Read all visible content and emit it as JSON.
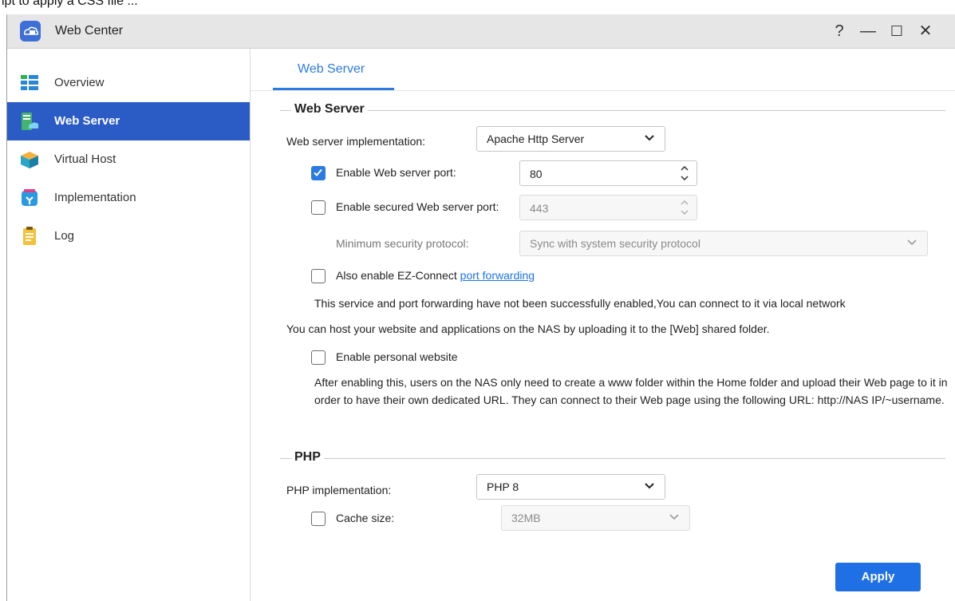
{
  "top_strip_text": "ipt to apply a CSS file ...",
  "window": {
    "title": "Web Center",
    "controls": {
      "help": "?",
      "minimize": "—",
      "maximize": "☐",
      "close": "✕"
    }
  },
  "sidebar": {
    "items": [
      {
        "label": "Overview",
        "icon": "overview-icon",
        "active": false
      },
      {
        "label": "Web Server",
        "icon": "web-server-icon",
        "active": true
      },
      {
        "label": "Virtual Host",
        "icon": "virtual-host-icon",
        "active": false
      },
      {
        "label": "Implementation",
        "icon": "implementation-icon",
        "active": false
      },
      {
        "label": "Log",
        "icon": "log-icon",
        "active": false
      }
    ]
  },
  "tabs": [
    {
      "label": "Web Server",
      "active": true
    }
  ],
  "web_server": {
    "section_title": "Web Server",
    "implementation_label": "Web server implementation:",
    "implementation_value": "Apache Http Server",
    "port_label": "Enable Web server port:",
    "port_checked": true,
    "port_value": "80",
    "secure_port_label": "Enable secured Web server port:",
    "secure_port_checked": false,
    "secure_port_value": "443",
    "min_protocol_label": "Minimum security protocol:",
    "min_protocol_value": "Sync with system security protocol",
    "ez_connect_label": "Also enable EZ-Connect",
    "ez_connect_link": "port forwarding",
    "ez_connect_checked": false,
    "status_note": "This service and port forwarding have not been successfully enabled,You can connect to it via local network",
    "host_note": "You can host your website and applications on the NAS by uploading it to the [Web] shared folder.",
    "personal_label": "Enable personal website",
    "personal_checked": false,
    "personal_desc": "After enabling this, users on the NAS only need to create a www folder within the Home folder and upload their Web page to it in order to have their own dedicated URL. They can connect to their Web page using the following URL: http://NAS IP/~username."
  },
  "php": {
    "section_title": "PHP",
    "implementation_label": "PHP implementation:",
    "implementation_value": "PHP 8",
    "cache_label": "Cache size:",
    "cache_checked": false,
    "cache_value": "32MB"
  },
  "apply_label": "Apply",
  "colors": {
    "accent": "#2b7be3",
    "sidebar_active": "#2b5cc6",
    "apply": "#1f6fe5"
  }
}
